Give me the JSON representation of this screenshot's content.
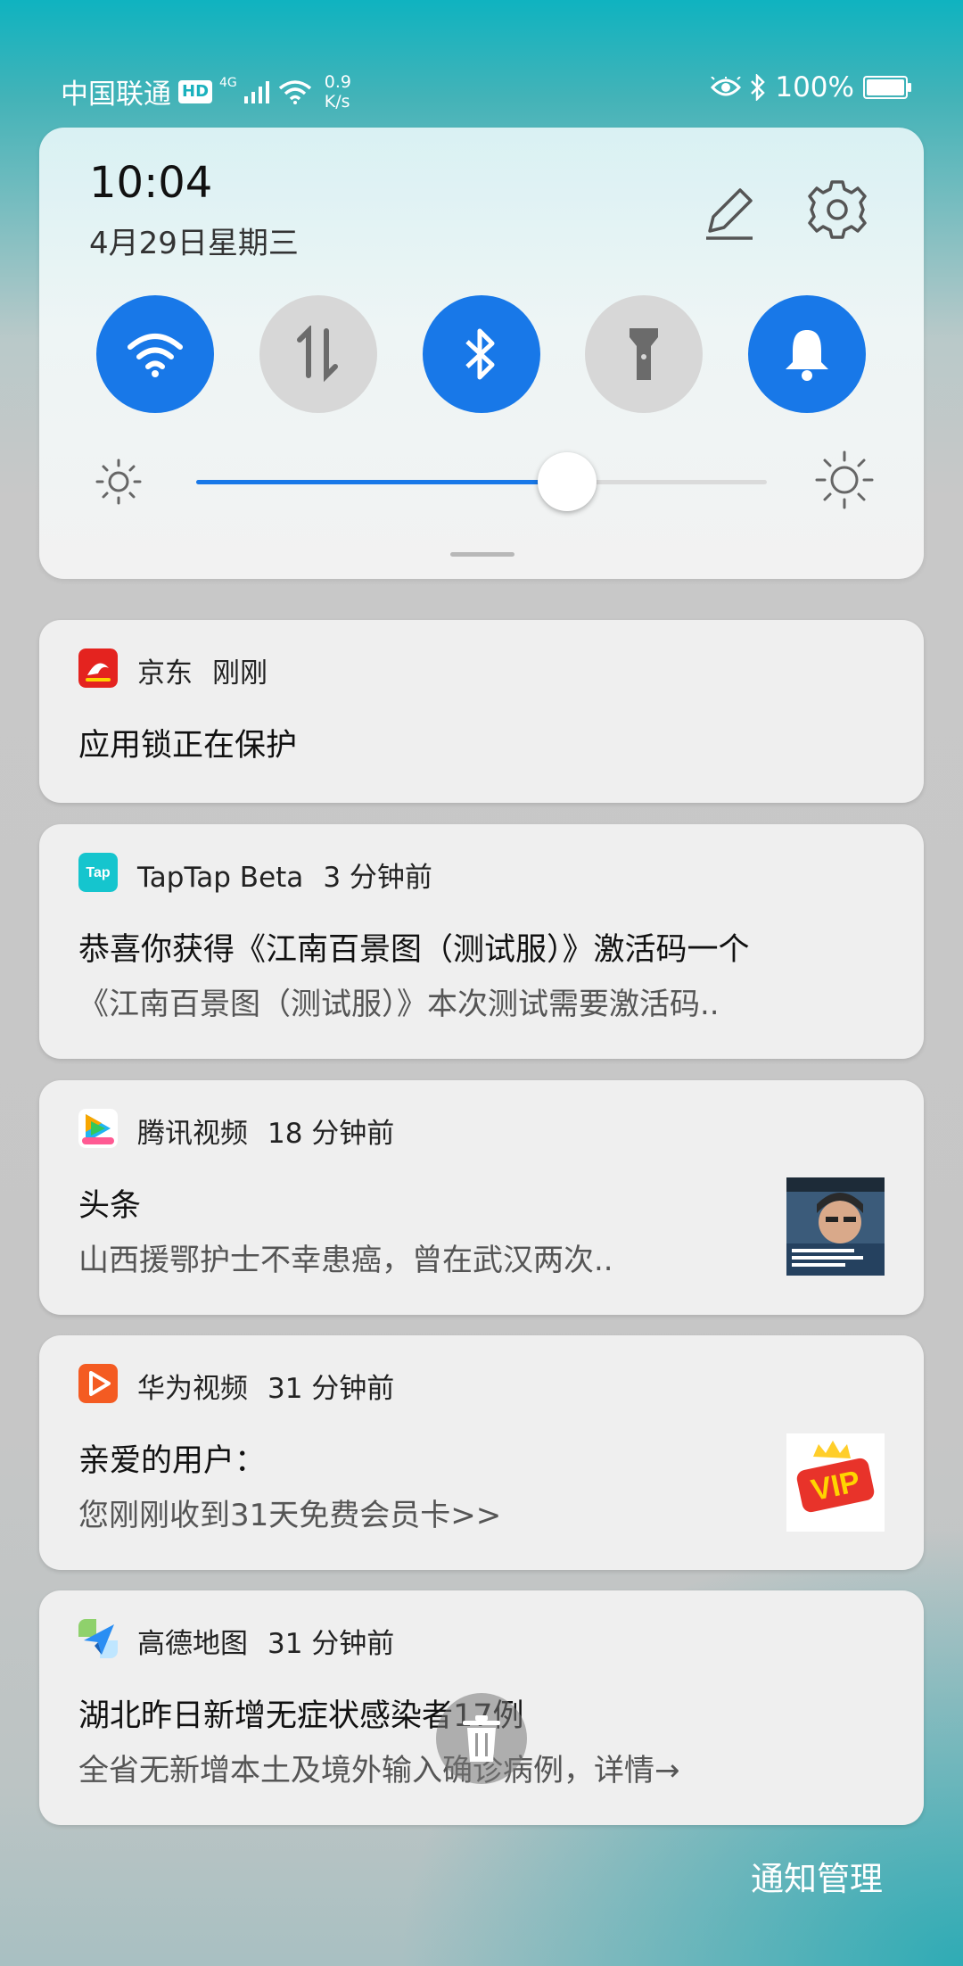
{
  "status_bar": {
    "carrier": "中国联通",
    "hd": "HD",
    "network": "4G",
    "speed_value": "0.9",
    "speed_unit": "K/s",
    "battery": "100%",
    "battery_level": 1.0
  },
  "quick_settings": {
    "time": "10:04",
    "date": "4月29日星期三",
    "toggles": [
      {
        "name": "wifi",
        "on": true
      },
      {
        "name": "mobile-data",
        "on": false
      },
      {
        "name": "bluetooth",
        "on": true
      },
      {
        "name": "flashlight",
        "on": false
      },
      {
        "name": "sound",
        "on": true
      }
    ],
    "brightness_level": 0.65,
    "accent_color": "#1878e8"
  },
  "notifications": [
    {
      "app": "京东",
      "time": "刚刚",
      "title": "应用锁正在保护",
      "body": "",
      "icon": "jd-app-icon",
      "icon_color": "#e4231f"
    },
    {
      "app": "TapTap Beta",
      "time": "3 分钟前",
      "title": "恭喜你获得《江南百景图（测试服）》激活码一个",
      "body": "《江南百景图（测试服）》本次测试需要激活码..",
      "icon": "taptap-app-icon",
      "icon_color": "#15c5ce"
    },
    {
      "app": "腾讯视频",
      "time": "18 分钟前",
      "title": "头条",
      "body": "山西援鄂护士不幸患癌，曾在武汉两次..",
      "icon": "tencent-video-app-icon",
      "icon_color": "#ffffff"
    },
    {
      "app": "华为视频",
      "time": "31 分钟前",
      "title": "亲爱的用户：",
      "body": "您刚刚收到31天免费会员卡>>",
      "icon": "huawei-video-app-icon",
      "icon_color": "#f45b22"
    },
    {
      "app": "高德地图",
      "time": "31 分钟前",
      "title": "湖北昨日新增无症状感染者17例",
      "body": "全省无新增本土及境外输入确诊病例，详情→",
      "icon": "amap-app-icon",
      "icon_color": "#2a8ef3"
    }
  ],
  "vip_badge": "VIP",
  "notification_manage": "通知管理"
}
